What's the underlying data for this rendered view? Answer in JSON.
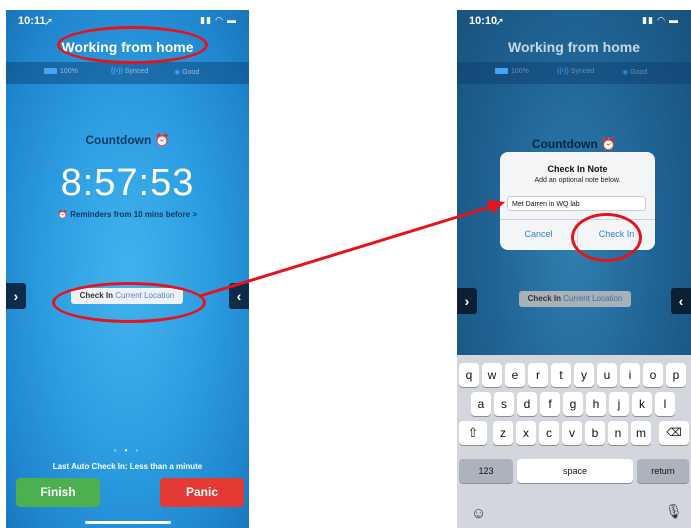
{
  "left": {
    "status_time": "10:11",
    "title": "Working from home",
    "battery": "100%",
    "sync": "Synced",
    "signal": "Good",
    "countdown_label": "Countdown",
    "timer": "8:57:53",
    "reminder": "Reminders from 10 mins before >",
    "checkin_label": "Check In",
    "location_label": "Current Location",
    "page_dots": "•",
    "last_auto": "Last Auto Check In: Less than a minute",
    "finish": "Finish",
    "panic": "Panic"
  },
  "right": {
    "status_time": "10:10",
    "title": "Working from home",
    "battery": "100%",
    "sync": "Synced",
    "signal": "Good",
    "countdown_label": "Countdown",
    "dialog_title": "Check In Note",
    "dialog_subtitle": "Add an optional note below.",
    "dialog_input_value": "Met Darren in WQ lab",
    "cancel": "Cancel",
    "check_in": "Check In",
    "checkin_label": "Check In",
    "location_label": "Current Location",
    "keyboard": {
      "row1": [
        "q",
        "w",
        "e",
        "r",
        "t",
        "y",
        "u",
        "i",
        "o",
        "p"
      ],
      "row2": [
        "a",
        "s",
        "d",
        "f",
        "g",
        "h",
        "j",
        "k",
        "l"
      ],
      "row3": [
        "z",
        "x",
        "c",
        "v",
        "b",
        "n",
        "m"
      ],
      "numbers": "123",
      "space": "space",
      "return": "return"
    }
  },
  "colors": {
    "annotation": "#e8121a",
    "finish": "#4caf50",
    "panic": "#e53935",
    "accent_link": "#2f7fd6"
  }
}
